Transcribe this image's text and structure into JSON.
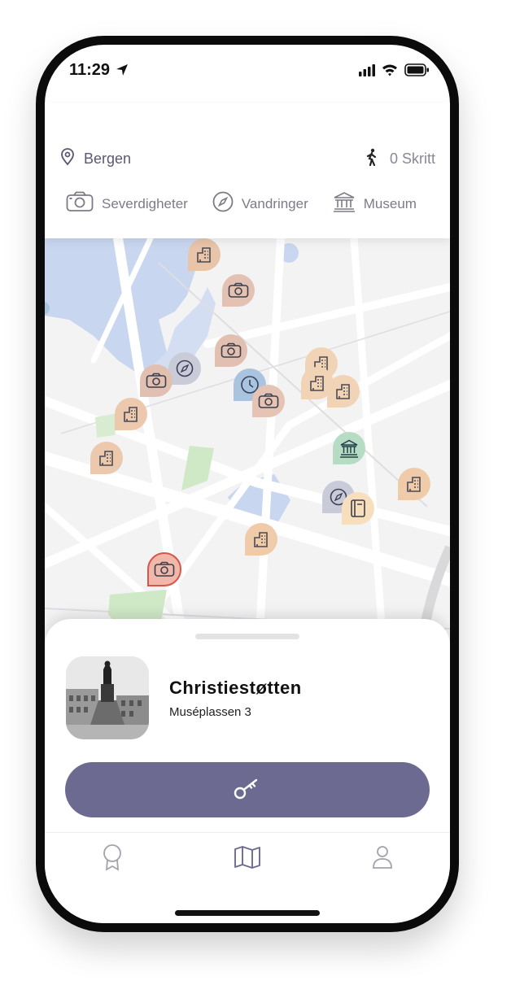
{
  "status_bar": {
    "time": "11:29"
  },
  "header": {
    "city": "Bergen",
    "steps": "0 Skritt",
    "categories": [
      {
        "label": "Severdigheter",
        "icon": "camera-icon"
      },
      {
        "label": "Vandringer",
        "icon": "compass-icon"
      },
      {
        "label": "Museum",
        "icon": "museum-icon"
      }
    ]
  },
  "map": {
    "pins": [
      {
        "type": "building",
        "color": "#e8c4a8"
      },
      {
        "type": "camera",
        "color": "#e3c2b4"
      },
      {
        "type": "camera",
        "color": "#e1c0b2"
      },
      {
        "type": "compass",
        "color": "#c9ccd8"
      },
      {
        "type": "camera",
        "color": "#e1c0b2"
      },
      {
        "type": "clock",
        "color": "#aac4e0"
      },
      {
        "type": "camera",
        "color": "#e5c3b5"
      },
      {
        "type": "building",
        "color": "#f1d4b5"
      },
      {
        "type": "building",
        "color": "#f1d4b5"
      },
      {
        "type": "building",
        "color": "#f1d4b5"
      },
      {
        "type": "building",
        "color": "#ecc9ac"
      },
      {
        "type": "museum",
        "color": "#b7dcc4"
      },
      {
        "type": "building",
        "color": "#f0cba9"
      },
      {
        "type": "compass",
        "color": "#c9ccd8"
      },
      {
        "type": "book",
        "color": "#f7dfbd"
      },
      {
        "type": "building",
        "color": "#f0cba9"
      },
      {
        "type": "camera-selected",
        "color": "#f0b8aa"
      },
      {
        "type": "building",
        "color": "#f0cba9"
      }
    ]
  },
  "sheet": {
    "title": "Christiestøtten",
    "address": "Muséplassen 3",
    "unlock_icon": "key-icon",
    "accent": "#6d6a91"
  },
  "tabbar": {
    "tabs": [
      {
        "icon": "award-icon"
      },
      {
        "icon": "map-icon",
        "active": true
      },
      {
        "icon": "profile-icon"
      }
    ]
  }
}
